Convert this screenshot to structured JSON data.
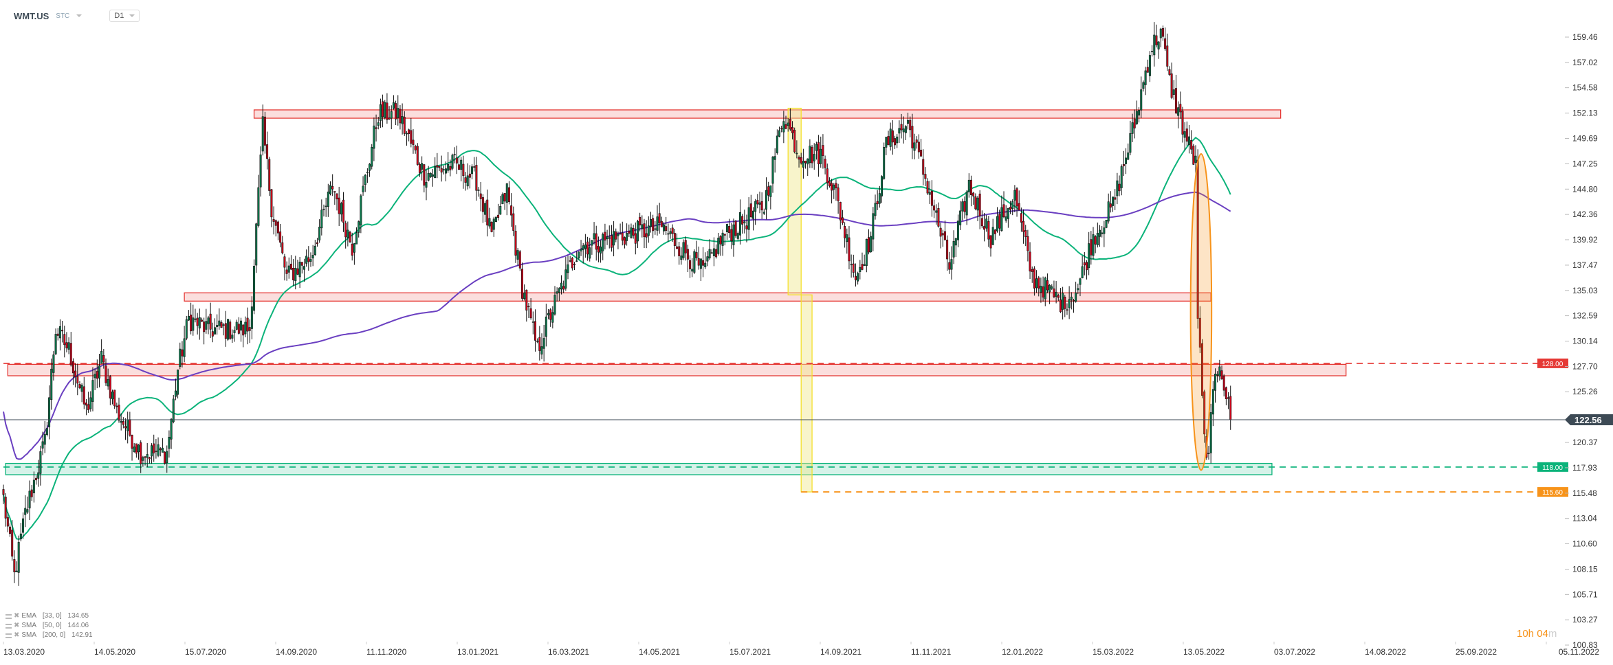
{
  "header": {
    "symbol": "WMT.US",
    "type": "STC",
    "timeframe": "D1"
  },
  "legend": [
    {
      "name": "EMA",
      "params": "[33,  0]",
      "value": "134.65"
    },
    {
      "name": "SMA",
      "params": "[50,  0]",
      "value": "144.06"
    },
    {
      "name": "SMA",
      "params": "[200,  0]",
      "value": "142.91"
    }
  ],
  "timer": {
    "hours": "10h 04",
    "m": "m"
  },
  "colors": {
    "up": "#0b7a4e",
    "down": "#d0021b",
    "sma50": "#0bb37a",
    "sma200": "#6a3fc1",
    "resist": "#e53935",
    "support": "#0bb37a",
    "target": "#f7931a",
    "current": "#3d4a55"
  },
  "chart_data": {
    "type": "candlestick",
    "title": "WMT.US D1",
    "ylim": [
      100.83,
      159.46
    ],
    "y_ticks": [
      "159.46",
      "157.02",
      "154.58",
      "152.13",
      "149.69",
      "147.25",
      "144.80",
      "142.36",
      "139.92",
      "137.47",
      "135.03",
      "132.59",
      "130.14",
      "127.70",
      "125.26",
      "120.37",
      "117.93",
      "115.48",
      "113.04",
      "110.60",
      "108.15",
      "105.71",
      "103.27",
      "100.83"
    ],
    "x_ticks": [
      "13.03.2020",
      "14.05.2020",
      "15.07.2020",
      "14.09.2020",
      "11.11.2020",
      "13.01.2021",
      "16.03.2021",
      "14.05.2021",
      "15.07.2021",
      "14.09.2021",
      "11.11.2021",
      "12.01.2022",
      "15.03.2022",
      "13.05.2022",
      "03.07.2022",
      "14.08.2022",
      "25.09.2022",
      "05.11.2022"
    ],
    "close_waypoints_day_price": [
      [
        0,
        115
      ],
      [
        5,
        107.5
      ],
      [
        10,
        113.5
      ],
      [
        19,
        120.4
      ],
      [
        24,
        131.3
      ],
      [
        30,
        129.3
      ],
      [
        38,
        123.4
      ],
      [
        45,
        128.4
      ],
      [
        52,
        123.4
      ],
      [
        63,
        119.4
      ],
      [
        75,
        119.4
      ],
      [
        80,
        127.4
      ],
      [
        85,
        132.3
      ],
      [
        94,
        131.3
      ],
      [
        113,
        131.3
      ],
      [
        119,
        150.7
      ],
      [
        123,
        143.2
      ],
      [
        130,
        136.3
      ],
      [
        141,
        138.3
      ],
      [
        151,
        145.2
      ],
      [
        160,
        139.3
      ],
      [
        172,
        152.1
      ],
      [
        181,
        152.1
      ],
      [
        193,
        146.2
      ],
      [
        207,
        147.2
      ],
      [
        217,
        145.7
      ],
      [
        224,
        140.2
      ],
      [
        231,
        144.7
      ],
      [
        238,
        135.3
      ],
      [
        245,
        129.3
      ],
      [
        252,
        133.3
      ],
      [
        264,
        139.3
      ],
      [
        283,
        140.2
      ],
      [
        302,
        141.2
      ],
      [
        321,
        136.8
      ],
      [
        330,
        140.2
      ],
      [
        349,
        143.2
      ],
      [
        358,
        152.1
      ],
      [
        365,
        148.2
      ],
      [
        375,
        148.2
      ],
      [
        382,
        144.2
      ],
      [
        391,
        136.3
      ],
      [
        398,
        140.2
      ],
      [
        405,
        149.2
      ],
      [
        415,
        151.1
      ],
      [
        424,
        145.2
      ],
      [
        434,
        137.3
      ],
      [
        443,
        145.2
      ],
      [
        453,
        140.2
      ],
      [
        464,
        144.2
      ],
      [
        472,
        136.3
      ],
      [
        486,
        133.8
      ],
      [
        493,
        135.3
      ],
      [
        500,
        140.2
      ],
      [
        509,
        143.2
      ],
      [
        519,
        151.1
      ],
      [
        526,
        158.1
      ],
      [
        531,
        160.1
      ],
      [
        535,
        155.1
      ],
      [
        542,
        150.2
      ],
      [
        547,
        147.2
      ],
      [
        548,
        132.8
      ],
      [
        551,
        120.4
      ],
      [
        552,
        118.4
      ],
      [
        556,
        126.4
      ],
      [
        558,
        128.4
      ],
      [
        561,
        124.9
      ],
      [
        563,
        122.56
      ]
    ],
    "current_price": {
      "value": "122.56"
    },
    "levels": [
      {
        "name": "resistance-128",
        "price": 128.0,
        "label": "128.00",
        "from_day": 0,
        "color": "#e53935"
      },
      {
        "name": "support-118",
        "price": 118.0,
        "label": "118.00",
        "from_day": 0,
        "color": "#0bb37a"
      },
      {
        "name": "target-115-60",
        "price": 115.6,
        "label": "115.60",
        "from_day": 366,
        "color": "#f7931a"
      }
    ],
    "zones": [
      {
        "name": "resistance-zone-152",
        "day": [
          115,
          586
        ],
        "price": [
          151.64,
          152.44
        ],
        "kind": "red"
      },
      {
        "name": "resistance-zone-135",
        "day": [
          83,
          554
        ],
        "price": [
          134.0,
          134.8
        ],
        "kind": "red"
      },
      {
        "name": "resistance-zone-127",
        "day": [
          2,
          616
        ],
        "price": [
          126.8,
          127.9
        ],
        "kind": "red"
      },
      {
        "name": "support-zone-118",
        "day": [
          1,
          582
        ],
        "price": [
          117.26,
          118.35
        ],
        "kind": "green"
      },
      {
        "name": "measured-move-1",
        "day": [
          360,
          366
        ],
        "price": [
          134.6,
          152.6
        ],
        "kind": "yellow"
      },
      {
        "name": "measured-move-2",
        "day": [
          366,
          371
        ],
        "price": [
          115.6,
          134.6
        ],
        "kind": "yellow"
      }
    ],
    "ellipse": {
      "day": [
        545,
        554
      ],
      "price": [
        117.7,
        148.2
      ]
    },
    "moving_averages": [
      {
        "name": "SMA 50",
        "period": 50,
        "color": "#0bb37a"
      },
      {
        "name": "SMA 200",
        "period": 200,
        "color": "#6a3fc1"
      }
    ]
  }
}
